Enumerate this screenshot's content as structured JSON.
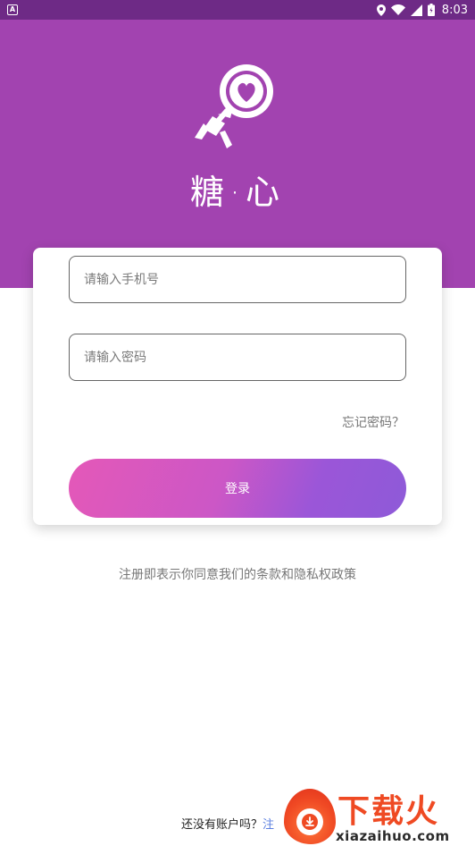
{
  "status_bar": {
    "notification_icon": "A",
    "time": "8:03"
  },
  "brand": {
    "name": "糖·心"
  },
  "login": {
    "phone_placeholder": "请输入手机号",
    "password_placeholder": "请输入密码",
    "forgot_label": "忘记密码？",
    "login_label": "登录"
  },
  "terms": {
    "text": "注册即表示你同意我们的条款和隐私权政策"
  },
  "register": {
    "prompt": "还没有账户吗？",
    "link": "注"
  },
  "watermark": {
    "title": "下载火",
    "url": "xiazaihuo.com"
  },
  "colors": {
    "hero": "#a243b0",
    "status_bar": "#6e2a86",
    "button_start": "#e458b8",
    "button_end": "#8e5ad8",
    "link": "#5b7fe0"
  }
}
